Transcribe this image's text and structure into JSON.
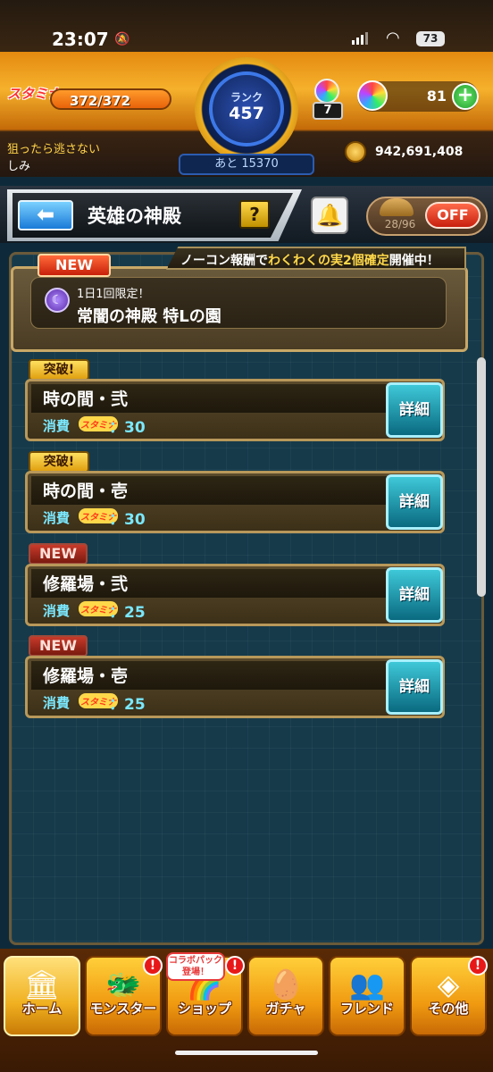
{
  "status_bar": {
    "time": "23:07",
    "battery": "73"
  },
  "player": {
    "stamina_label": "スタミナ",
    "stamina": "372/372",
    "name_line1": "狙ったら逃さない",
    "name_line2": "しみ",
    "rank_label": "ランク",
    "rank": "457",
    "rank_next": "あと 15370",
    "orb_small_count": "7",
    "orbs": "81",
    "gold": "942,691,408"
  },
  "header": {
    "back_glyph": "⬅",
    "title": "英雄の神殿",
    "help": "?",
    "auto_count": "28/96",
    "off_label": "OFF"
  },
  "event_banner": {
    "prefix": "ノーコン報酬で",
    "highlight": "わくわくの実2個確定",
    "suffix": "開催中！"
  },
  "featured": {
    "badge": "NEW",
    "subtitle": "1日1回限定！",
    "title": "常闇の神殿 特Lの園"
  },
  "quests": [
    {
      "badge": "突破!",
      "name": "時の間・弐",
      "cost_label": "消費",
      "stamina_tag": "スタミナ",
      "cost": "：30",
      "detail": "詳細"
    },
    {
      "badge": "突破!",
      "name": "時の間・壱",
      "cost_label": "消費",
      "stamina_tag": "スタミナ",
      "cost": "：30",
      "detail": "詳細"
    },
    {
      "badge": "NEW",
      "name": "修羅場・弐",
      "cost_label": "消費",
      "stamina_tag": "スタミナ",
      "cost": "：25",
      "detail": "詳細"
    },
    {
      "badge": "NEW",
      "name": "修羅場・壱",
      "cost_label": "消費",
      "stamina_tag": "スタミナ",
      "cost": "：25",
      "detail": "詳細"
    }
  ],
  "nav": {
    "collab_tag": "コラボパック登場！",
    "alert": "!",
    "items": [
      {
        "label": "ホーム",
        "icon": "home-icon"
      },
      {
        "label": "モンスター",
        "icon": "monster-icon"
      },
      {
        "label": "ショップ",
        "icon": "shop-icon"
      },
      {
        "label": "ガチャ",
        "icon": "gacha-icon"
      },
      {
        "label": "フレンド",
        "icon": "friend-icon"
      },
      {
        "label": "その他",
        "icon": "other-icon"
      }
    ]
  }
}
